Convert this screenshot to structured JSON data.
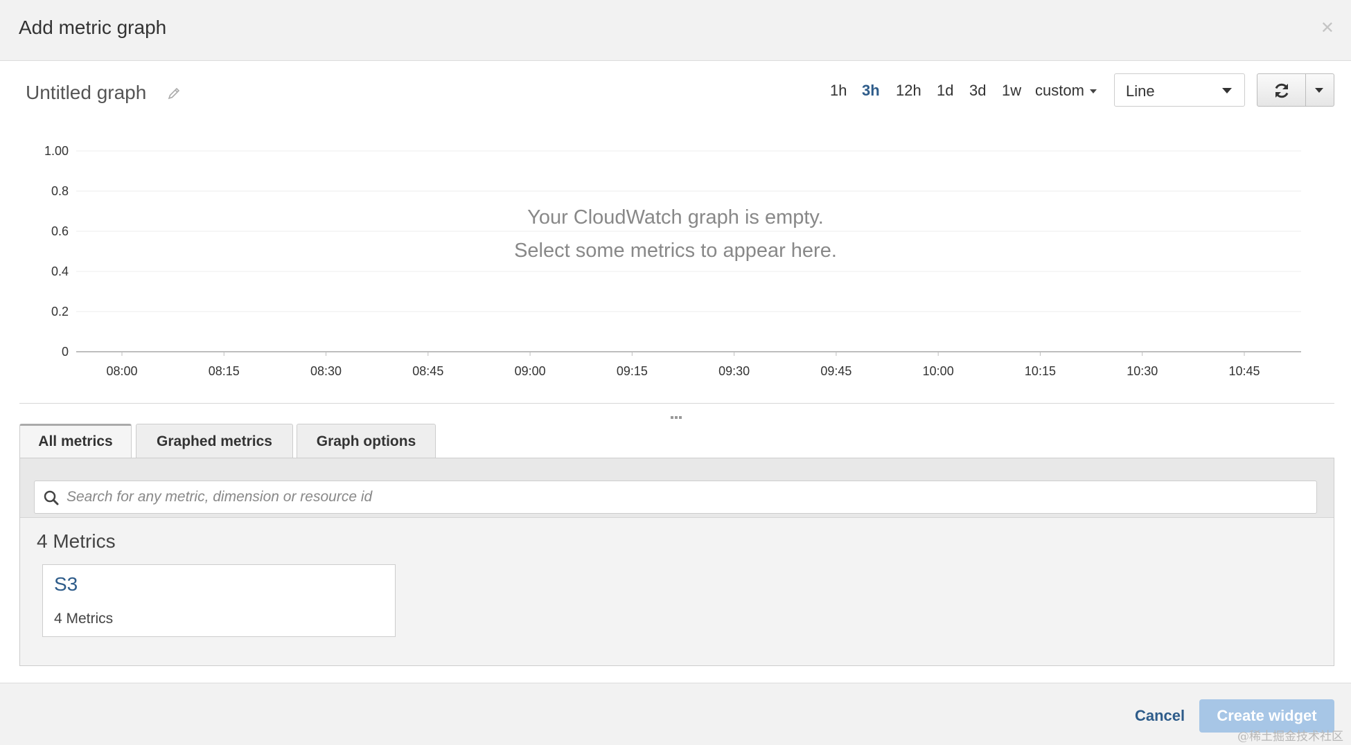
{
  "header": {
    "title": "Add metric graph",
    "close_icon": "close-icon"
  },
  "graph": {
    "title": "Untitled graph",
    "edit_icon": "pencil-icon",
    "time_ranges": [
      "1h",
      "3h",
      "12h",
      "1d",
      "3d",
      "1w"
    ],
    "active_range": "3h",
    "custom_label": "custom",
    "graph_type": "Line",
    "refresh_icon": "refresh-icon"
  },
  "empty_state": {
    "line1": "Your CloudWatch graph is empty.",
    "line2": "Select some metrics to appear here."
  },
  "chart_data": {
    "type": "line",
    "series": [],
    "x_ticks": [
      "08:00",
      "08:15",
      "08:30",
      "08:45",
      "09:00",
      "09:15",
      "09:30",
      "09:45",
      "10:00",
      "10:15",
      "10:30",
      "10:45"
    ],
    "y_ticks": [
      "1.00",
      "0.8",
      "0.6",
      "0.4",
      "0.2",
      "0"
    ],
    "ylim": [
      0,
      1
    ],
    "grid": true
  },
  "tabs": [
    {
      "label": "All metrics",
      "active": true
    },
    {
      "label": "Graphed metrics",
      "active": false
    },
    {
      "label": "Graph options",
      "active": false
    }
  ],
  "search": {
    "placeholder": "Search for any metric, dimension or resource id",
    "value": ""
  },
  "metrics": {
    "count_label": "4 Metrics",
    "namespaces": [
      {
        "name": "S3",
        "count_label": "4 Metrics"
      }
    ]
  },
  "footer": {
    "cancel_label": "Cancel",
    "create_label": "Create widget"
  },
  "watermark": "@稀土掘金技术社区",
  "colors": {
    "link": "#2e5c8a",
    "create_disabled": "#a7c6e6"
  }
}
